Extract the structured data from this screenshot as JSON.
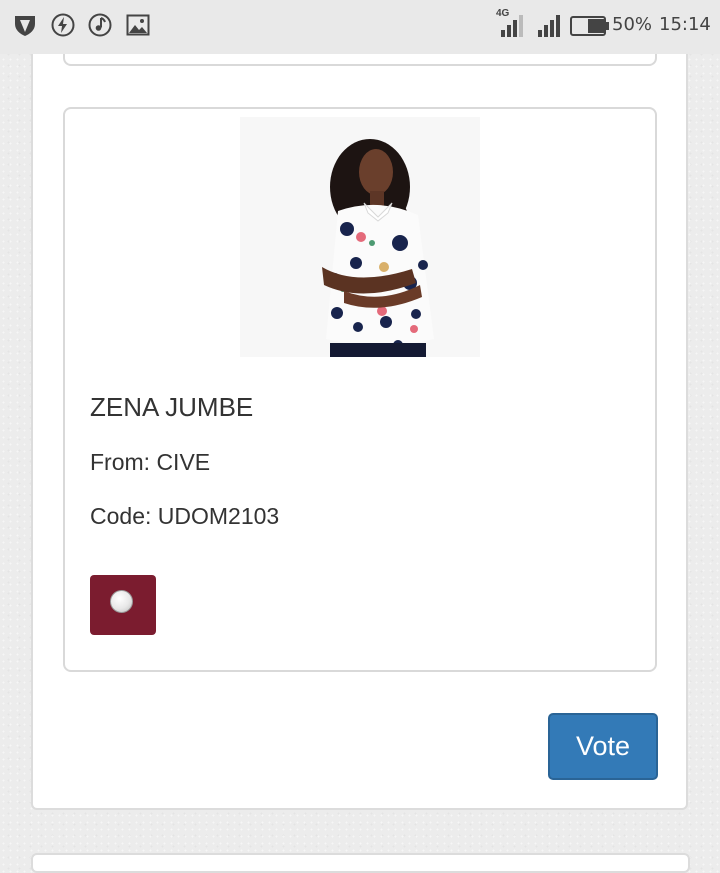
{
  "status_bar": {
    "network_label": "4G",
    "battery_percent": "50%",
    "time": "15:14",
    "battery_level": 0.5,
    "icons": [
      "shield-icon",
      "flash-icon",
      "music-icon",
      "image-icon",
      "signal-4g-icon",
      "signal-icon",
      "battery-icon"
    ]
  },
  "candidate": {
    "name": "ZENA JUMBE",
    "from_line": "From: CIVE",
    "code_line": "Code: UDOM2103",
    "radio_selected": false
  },
  "vote_button": {
    "label": "Vote"
  },
  "colors": {
    "radio_bg": "#7b1c2f",
    "vote_bg": "#337ab7"
  }
}
